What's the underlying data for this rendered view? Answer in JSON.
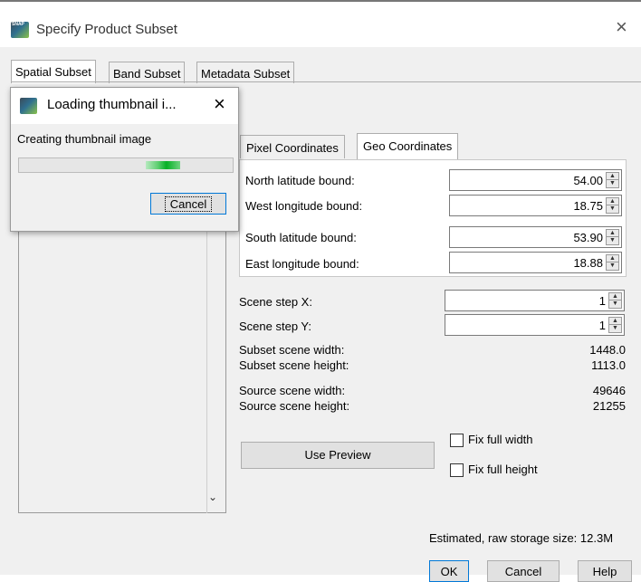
{
  "window": {
    "title": "Specify Product Subset",
    "close_glyph": "×",
    "icon": "snap-app-icon"
  },
  "tabs": [
    {
      "label": "Spatial Subset",
      "active": true
    },
    {
      "label": "Band Subset",
      "active": false
    },
    {
      "label": "Metadata Subset",
      "active": false
    }
  ],
  "coord_tabs": [
    {
      "label": "Pixel Coordinates",
      "active": false
    },
    {
      "label": "Geo Coordinates",
      "active": true
    }
  ],
  "geo": {
    "north_label": "North latitude bound:",
    "north_value": "54.00",
    "west_label": "West longitude bound:",
    "west_value": "18.75",
    "south_label": "South latitude bound:",
    "south_value": "53.90",
    "east_label": "East longitude bound:",
    "east_value": "18.88"
  },
  "scene": {
    "step_x_label": "Scene step X:",
    "step_x_value": "1",
    "step_y_label": "Scene step Y:",
    "step_y_value": "1",
    "subset_width_label": "Subset scene width:",
    "subset_width_value": "1448.0",
    "subset_height_label": "Subset scene height:",
    "subset_height_value": "1113.0",
    "source_width_label": "Source scene width:",
    "source_width_value": "49646",
    "source_height_label": "Source scene height:",
    "source_height_value": "21255"
  },
  "preview": {
    "use_preview_label": "Use Preview",
    "fix_width_label": "Fix full width",
    "fix_width_checked": false,
    "fix_height_label": "Fix full height",
    "fix_height_checked": false
  },
  "footer": {
    "storage_label": "Estimated, raw storage size: 12.3M",
    "ok_label": "OK",
    "cancel_label": "Cancel",
    "help_label": "Help"
  },
  "loading_popup": {
    "title": "Loading thumbnail i...",
    "close_glyph": "×",
    "message": "Creating thumbnail image",
    "cancel_label": "Cancel",
    "progress_indeterminate": true
  },
  "colors": {
    "progress_green": "#06b025",
    "dialog_bg": "#f0f0f0",
    "focus_blue": "#0078d7"
  }
}
